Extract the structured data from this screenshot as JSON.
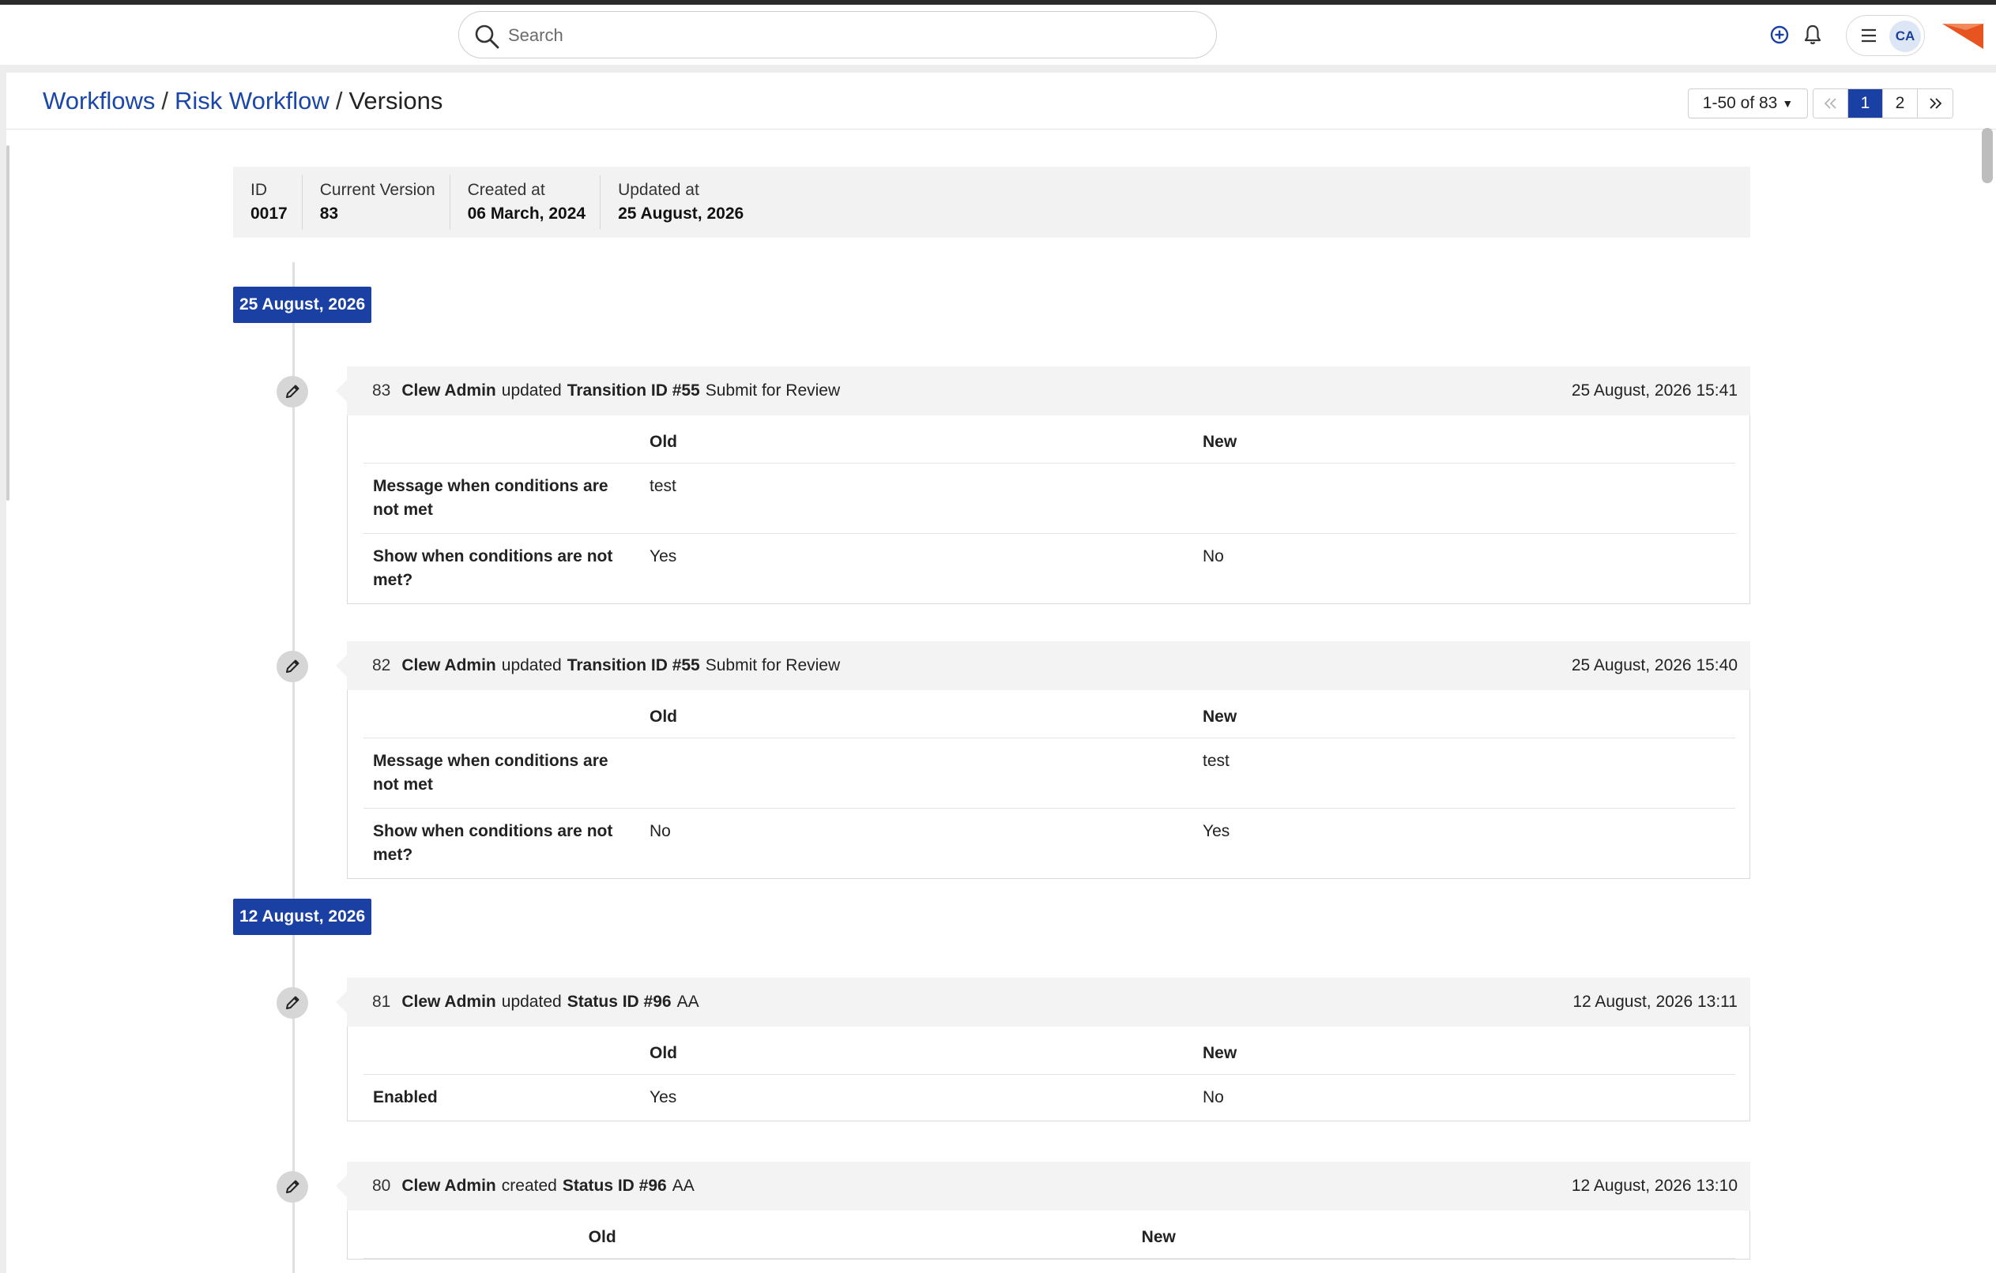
{
  "topbar": {
    "search_placeholder": "Search",
    "avatar_initials": "CA",
    "accent": "#1a40a3",
    "brand_color": "#e8541f"
  },
  "breadcrumb": {
    "workflows": "Workflows",
    "workflow_name": "Risk Workflow",
    "current": "Versions",
    "separator": "/"
  },
  "pagination": {
    "range": "1-50 of 83",
    "pages": [
      "1",
      "2"
    ],
    "current_page": "1"
  },
  "summary": [
    {
      "label": "ID",
      "value": "0017"
    },
    {
      "label": "Current Version",
      "value": "83"
    },
    {
      "label": "Created at",
      "value": "06 March, 2024"
    },
    {
      "label": "Updated at",
      "value": "25 August, 2026"
    }
  ],
  "groups": [
    {
      "date": "25 August, 2026",
      "entries": [
        {
          "num": "83",
          "user": "Clew Admin",
          "action": "updated",
          "target": "Transition ID #55",
          "target_name": "Submit for Review",
          "timestamp": "25 August, 2026 15:41",
          "columns": {
            "old": "Old",
            "new": "New"
          },
          "rows": [
            {
              "field": "Message when conditions are not met",
              "old": "test",
              "new": ""
            },
            {
              "field": "Show when conditions are not met?",
              "old": "Yes",
              "new": "No"
            }
          ]
        },
        {
          "num": "82",
          "user": "Clew Admin",
          "action": "updated",
          "target": "Transition ID #55",
          "target_name": "Submit for Review",
          "timestamp": "25 August, 2026 15:40",
          "columns": {
            "old": "Old",
            "new": "New"
          },
          "rows": [
            {
              "field": "Message when conditions are not met",
              "old": "",
              "new": "test"
            },
            {
              "field": "Show when conditions are not met?",
              "old": "No",
              "new": "Yes"
            }
          ]
        }
      ]
    },
    {
      "date": "12 August, 2026",
      "entries": [
        {
          "num": "81",
          "user": "Clew Admin",
          "action": "updated",
          "target": "Status ID #96",
          "target_name": "AA",
          "timestamp": "12 August, 2026 13:11",
          "columns": {
            "old": "Old",
            "new": "New"
          },
          "rows": [
            {
              "field": "Enabled",
              "old": "Yes",
              "new": "No"
            }
          ]
        },
        {
          "num": "80",
          "user": "Clew Admin",
          "action": "created",
          "target": "Status ID #96",
          "target_name": "AA",
          "timestamp": "12 August, 2026 13:10",
          "columns": {
            "old": "Old",
            "new": "New"
          },
          "rows": []
        }
      ]
    }
  ]
}
